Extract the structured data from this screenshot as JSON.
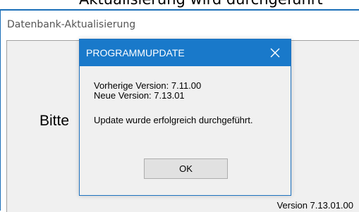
{
  "background_window": {
    "top_text": "Aktualisierung wird durchgeführt",
    "title": "Datenbank-Aktualisierung",
    "partial_message": "Bitte",
    "version_label": "Version 7.13.01.00"
  },
  "dialog": {
    "title": "PROGRAMMUPDATE",
    "previous_version": "Vorherige Version: 7.11.00",
    "new_version": "Neue Version: 7.13.01",
    "message": "Update wurde erfolgreich durchgeführt.",
    "ok_label": "OK",
    "close_icon": "close-icon"
  },
  "colors": {
    "titlebar_accent": "#1979ca",
    "window_border": "#1b6fb8",
    "dialog_background": "#f0f0f0"
  }
}
